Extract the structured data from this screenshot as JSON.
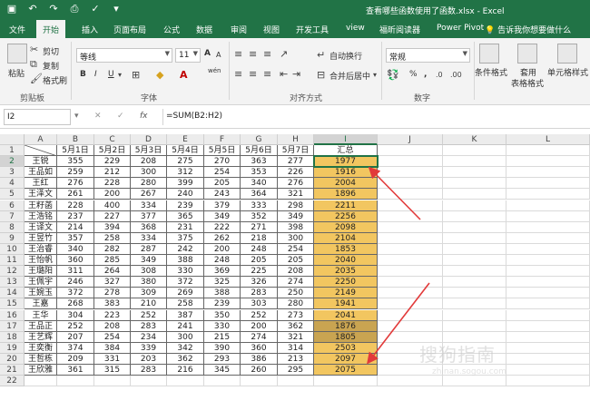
{
  "window": {
    "title": "查看哪些函数使用了函数.xlsx - Excel"
  },
  "tabs": [
    "文件",
    "开始",
    "插入",
    "页面布局",
    "公式",
    "数据",
    "审阅",
    "视图",
    "开发工具",
    "view",
    "福昕阅读器",
    "Power Pivot"
  ],
  "tell_me": "告诉我你想要做什么",
  "ribbon": {
    "clipboard": {
      "paste": "粘贴",
      "cut": "剪切",
      "copy": "复制",
      "format_painter": "格式刷",
      "label": "剪贴板"
    },
    "font": {
      "name": "等线",
      "size": "11",
      "bold": "B",
      "italic": "I",
      "underline": "U",
      "label": "字体",
      "wen": "wén",
      "grow": "A",
      "shrink": "A"
    },
    "alignment": {
      "wrap": "自动换行",
      "merge": "合并后居中",
      "label": "对齐方式"
    },
    "number": {
      "format": "常规",
      "percent": "%",
      "comma": ",",
      "label": "数字"
    },
    "styles": {
      "conditional": "条件格式",
      "table_a": "套用",
      "table_b": "表格格式",
      "cell_styles": "单元格样式"
    }
  },
  "formula_bar": {
    "name_box": "I2",
    "fx": "fx",
    "cancel": "✕",
    "enter": "✓",
    "formula": "=SUM(B2:H2)"
  },
  "columns": [
    "A",
    "B",
    "C",
    "D",
    "E",
    "F",
    "G",
    "H",
    "I",
    "J",
    "K",
    "L"
  ],
  "selected_column": "I",
  "selected_row": "2",
  "table": {
    "headers": [
      "5月1日",
      "5月2日",
      "5月3日",
      "5月4日",
      "5月5日",
      "5月6日",
      "5月7日",
      "汇总"
    ],
    "rows": [
      {
        "name": "王锐",
        "values": [
          "355",
          "229",
          "208",
          "275",
          "270",
          "363",
          "277",
          "1977"
        ]
      },
      {
        "name": "王品如",
        "values": [
          "259",
          "212",
          "300",
          "312",
          "254",
          "353",
          "226",
          "1916"
        ]
      },
      {
        "name": "王红",
        "values": [
          "276",
          "228",
          "280",
          "399",
          "205",
          "340",
          "276",
          "2004"
        ]
      },
      {
        "name": "王泽文",
        "values": [
          "261",
          "200",
          "267",
          "240",
          "243",
          "364",
          "321",
          "1896"
        ]
      },
      {
        "name": "王籽菡",
        "values": [
          "228",
          "400",
          "334",
          "239",
          "379",
          "333",
          "298",
          "2211"
        ]
      },
      {
        "name": "王浩铭",
        "values": [
          "237",
          "227",
          "377",
          "365",
          "349",
          "352",
          "349",
          "2256"
        ]
      },
      {
        "name": "王译文",
        "values": [
          "214",
          "394",
          "368",
          "231",
          "222",
          "271",
          "398",
          "2098"
        ]
      },
      {
        "name": "王昱竹",
        "values": [
          "357",
          "258",
          "334",
          "375",
          "262",
          "218",
          "300",
          "2104"
        ]
      },
      {
        "name": "王治睿",
        "values": [
          "340",
          "282",
          "287",
          "242",
          "200",
          "248",
          "254",
          "1853"
        ]
      },
      {
        "name": "王怡帆",
        "values": [
          "360",
          "285",
          "349",
          "388",
          "248",
          "205",
          "205",
          "2040"
        ]
      },
      {
        "name": "王璐阳",
        "values": [
          "311",
          "264",
          "308",
          "330",
          "369",
          "225",
          "208",
          "2035"
        ]
      },
      {
        "name": "王佩宇",
        "values": [
          "246",
          "327",
          "380",
          "372",
          "325",
          "326",
          "274",
          "2250"
        ]
      },
      {
        "name": "王婉玉",
        "values": [
          "372",
          "278",
          "309",
          "269",
          "388",
          "283",
          "250",
          "2149"
        ]
      },
      {
        "name": "王嘉",
        "values": [
          "268",
          "383",
          "210",
          "258",
          "239",
          "303",
          "280",
          "1941"
        ]
      },
      {
        "name": "王华",
        "values": [
          "304",
          "223",
          "252",
          "387",
          "350",
          "252",
          "273",
          "2041"
        ]
      },
      {
        "name": "王品正",
        "values": [
          "252",
          "208",
          "283",
          "241",
          "330",
          "200",
          "362",
          "1876"
        ]
      },
      {
        "name": "王艺辉",
        "values": [
          "207",
          "254",
          "234",
          "300",
          "215",
          "274",
          "321",
          "1805"
        ]
      },
      {
        "name": "王奕衡",
        "values": [
          "374",
          "384",
          "339",
          "342",
          "390",
          "360",
          "314",
          "2503"
        ]
      },
      {
        "name": "王哲栋",
        "values": [
          "209",
          "331",
          "203",
          "362",
          "293",
          "386",
          "213",
          "2097"
        ]
      },
      {
        "name": "王欣雅",
        "values": [
          "361",
          "315",
          "283",
          "216",
          "345",
          "260",
          "295",
          "2075"
        ]
      }
    ]
  },
  "row_numbers": [
    "1",
    "2",
    "3",
    "4",
    "5",
    "6",
    "7",
    "8",
    "9",
    "10",
    "11",
    "12",
    "13",
    "14",
    "15",
    "16",
    "17",
    "18",
    "19",
    "20",
    "21",
    "22"
  ],
  "watermark": "搜狗指南",
  "watermark_url": "zhinan.sogou.com"
}
